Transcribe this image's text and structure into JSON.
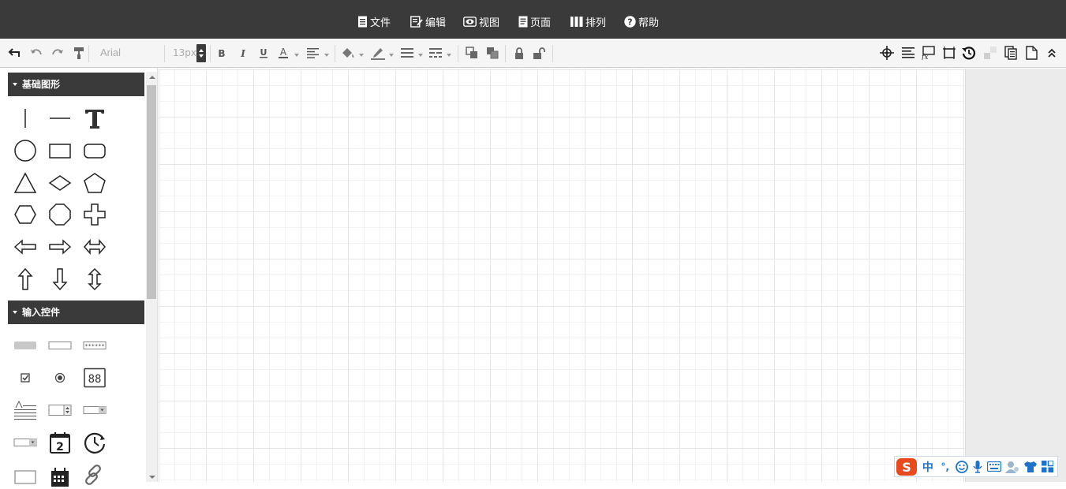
{
  "menu": {
    "file": "文件",
    "edit": "编辑",
    "view": "视图",
    "page": "页面",
    "arrange": "排列",
    "help": "帮助"
  },
  "toolbar": {
    "font_family": "Arial",
    "font_size": "13px"
  },
  "sidebar": {
    "panels": [
      {
        "title": "基础图形"
      },
      {
        "title": "输入控件"
      }
    ]
  },
  "ime": {
    "logo": "S",
    "mode": "中",
    "punct": "°,"
  },
  "colors": {
    "menubar_bg": "#3a3a3a",
    "toolbar_bg": "#f5f5f5",
    "ime_logo": "#e8491d",
    "ime_icons": "#1d73c9"
  }
}
